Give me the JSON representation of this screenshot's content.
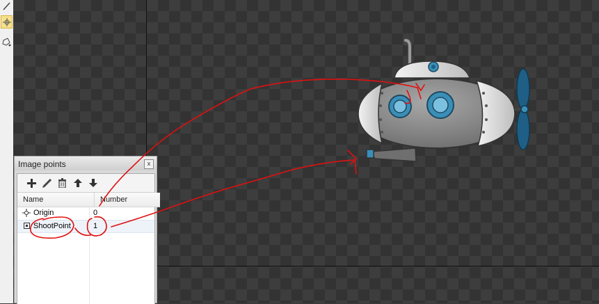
{
  "panel": {
    "title": "Image points",
    "close_label": "x",
    "columns": {
      "name": "Name",
      "number": "Number"
    },
    "rows": [
      {
        "name": "Origin",
        "number": "0",
        "icon": "crosshair-icon"
      },
      {
        "name": "ShootPoint",
        "number": "1",
        "icon": "square-point-icon"
      }
    ],
    "toolbar": [
      "add-icon",
      "edit-icon",
      "delete-icon",
      "move-up-icon",
      "move-down-icon"
    ]
  },
  "toolstrip": [
    "pencil-icon",
    "point-tool-icon",
    "polygon-tool-icon"
  ],
  "colors": {
    "annotation": "#e01010",
    "submarine_body": "#8a8a8a",
    "porthole": "#3a8fb8",
    "propeller": "#1f5f86"
  }
}
